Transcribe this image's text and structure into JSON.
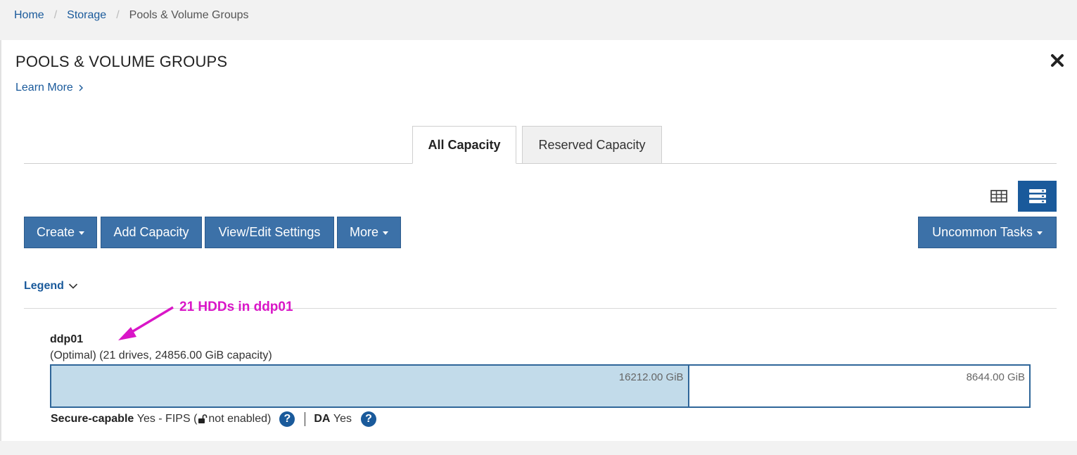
{
  "breadcrumb": {
    "home": "Home",
    "storage": "Storage",
    "current": "Pools & Volume Groups",
    "separator": "/"
  },
  "page": {
    "title": "POOLS & VOLUME GROUPS",
    "learn_more": "Learn More",
    "close_icon": "close-icon"
  },
  "tabs": [
    {
      "label": "All Capacity",
      "active": true
    },
    {
      "label": "Reserved Capacity",
      "active": false
    }
  ],
  "view_toggle": {
    "table_icon": "table-view-icon",
    "list_icon": "list-view-icon",
    "selected": "list"
  },
  "toolbar": {
    "create": "Create",
    "add_capacity": "Add Capacity",
    "view_edit": "View/Edit Settings",
    "more": "More",
    "uncommon": "Uncommon Tasks"
  },
  "legend": {
    "label": "Legend"
  },
  "annotation": {
    "text": "21 HDDs in ddp01",
    "color": "#d916c7"
  },
  "pool": {
    "name": "ddp01",
    "status": "(Optimal) (21 drives, 24856.00 GiB capacity)",
    "used_label": "16212.00 GiB",
    "free_label": "8644.00 GiB",
    "used_fraction": 0.6522,
    "secure_label": "Secure-capable",
    "secure_value_pre": "Yes - FIPS (",
    "secure_value_post": " not enabled)",
    "da_label": "DA",
    "da_value": "Yes",
    "help_glyph": "?"
  },
  "colors": {
    "accent": "#1a5a9b",
    "button": "#3c71a8",
    "bar_used": "#c2dbea",
    "bar_border": "#2f6699"
  }
}
